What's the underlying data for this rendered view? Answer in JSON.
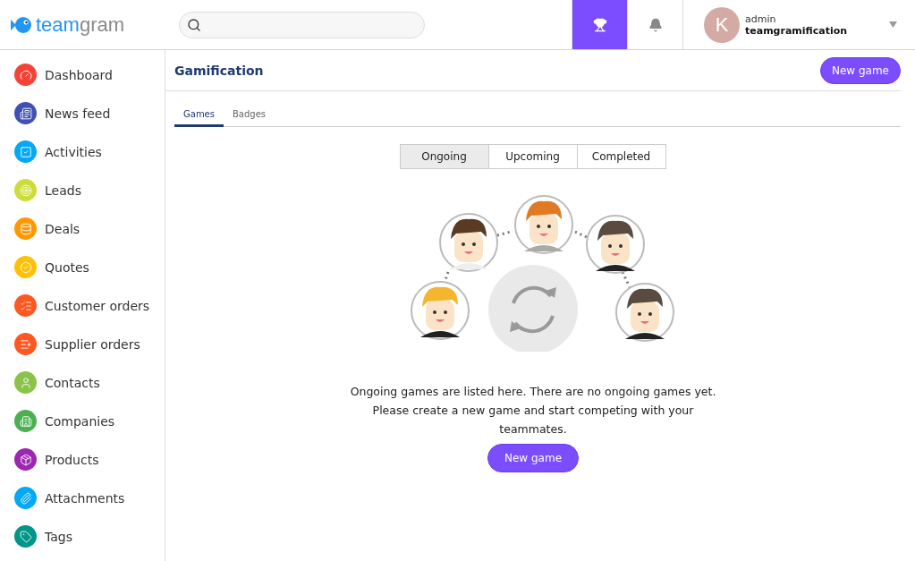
{
  "header": {
    "logo": {
      "part_1": "team",
      "part_2": "gram"
    },
    "trophy_active": true,
    "user": {
      "initial": "K",
      "role": "admin",
      "name": "teamgramification"
    }
  },
  "sidebar": {
    "items": [
      {
        "label": "Dashboard",
        "kind": "gauge",
        "color": "#f44336"
      },
      {
        "label": "News feed",
        "kind": "news",
        "color": "#3f51b5"
      },
      {
        "label": "Activities",
        "kind": "check",
        "color": "#03a9f4"
      },
      {
        "label": "Leads",
        "kind": "target",
        "color": "#cddc39"
      },
      {
        "label": "Deals",
        "kind": "coins",
        "color": "#ff9800"
      },
      {
        "label": "Quotes",
        "kind": "badge",
        "color": "#ffc107"
      },
      {
        "label": "Customer orders",
        "kind": "list-out",
        "color": "#ff5722"
      },
      {
        "label": "Supplier orders",
        "kind": "list-in",
        "color": "#ff5722"
      },
      {
        "label": "Contacts",
        "kind": "user",
        "color": "#8bc34a"
      },
      {
        "label": "Companies",
        "kind": "building",
        "color": "#4caf50"
      },
      {
        "label": "Products",
        "kind": "box",
        "color": "#9c27b0"
      },
      {
        "label": "Attachments",
        "kind": "clip",
        "color": "#03a9f4"
      },
      {
        "label": "Tags",
        "kind": "tag",
        "color": "#009688"
      }
    ]
  },
  "page": {
    "title": "Gamification",
    "new_game_button": "New game",
    "tabs": [
      {
        "label": "Games",
        "selected": true
      },
      {
        "label": "Badges",
        "selected": false
      }
    ],
    "filters": [
      {
        "label": "Ongoing",
        "selected": true
      },
      {
        "label": "Upcoming",
        "selected": false
      },
      {
        "label": "Completed",
        "selected": false
      }
    ],
    "empty_message": "Ongoing games are listed here. There are no ongoing games yet. Please create a new game and start competing with your teammates.",
    "empty_button": "New game"
  }
}
